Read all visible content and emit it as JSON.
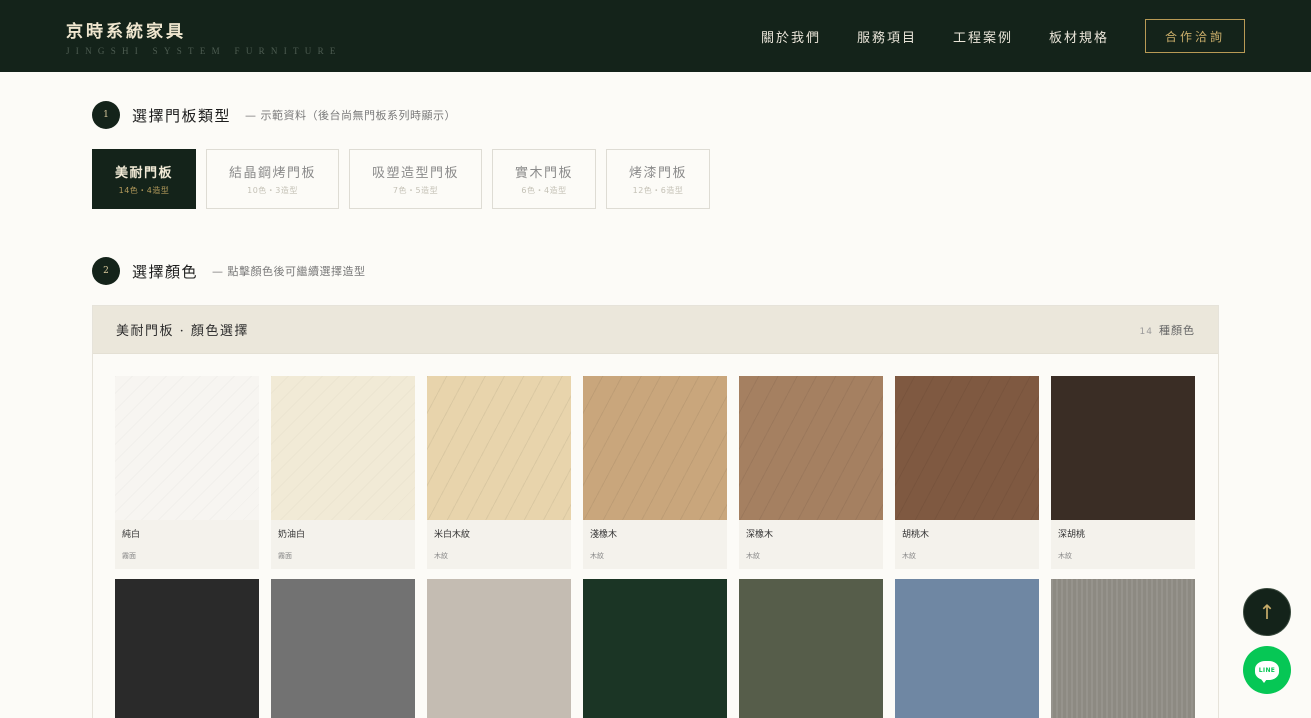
{
  "header": {
    "brand_title": "京時系統家具",
    "brand_subtitle": "JINGSHI SYSTEM FURNITURE",
    "nav": [
      "關於我們",
      "服務項目",
      "工程案例",
      "板材規格"
    ],
    "cta": "合作洽詢"
  },
  "step1": {
    "number": "1",
    "title": "選擇門板類型",
    "note": "— 示範資料（後台尚無門板系列時顯示）"
  },
  "door_types": [
    {
      "label": "美耐門板",
      "sub": "14色・4造型"
    },
    {
      "label": "結晶鋼烤門板",
      "sub": "10色・3造型"
    },
    {
      "label": "吸塑造型門板",
      "sub": "7色・5造型"
    },
    {
      "label": "實木門板",
      "sub": "6色・4造型"
    },
    {
      "label": "烤漆門板",
      "sub": "12色・6造型"
    }
  ],
  "step2": {
    "number": "2",
    "title": "選擇顏色",
    "note": "— 點擊顏色後可繼續選擇造型"
  },
  "panel": {
    "title": "美耐門板 · 顏色選擇",
    "count_num": "14",
    "count_label": "種顏色"
  },
  "colors_row1": [
    {
      "name": "純白",
      "category": "霧面",
      "hex": "#f7f5f1"
    },
    {
      "name": "奶油白",
      "category": "霧面",
      "hex": "#f1ead6"
    },
    {
      "name": "米白木紋",
      "category": "木紋",
      "hex": "#e8d4ac"
    },
    {
      "name": "淺橡木",
      "category": "木紋",
      "hex": "#c9a67c"
    },
    {
      "name": "深橡木",
      "category": "木紋",
      "hex": "#a58061"
    },
    {
      "name": "胡桃木",
      "category": "木紋",
      "hex": "#7f5941"
    },
    {
      "name": "深胡桃",
      "category": "木紋",
      "hex": "#3a2d25"
    }
  ],
  "colors_row2": [
    {
      "hex": "#2a2a2a"
    },
    {
      "hex": "#727272"
    },
    {
      "hex": "#c4bcb2"
    },
    {
      "hex": "#1b3525"
    },
    {
      "hex": "#565d4a"
    },
    {
      "hex": "#6f87a3"
    },
    {
      "hex": "#8d8a82"
    }
  ],
  "icons": {
    "back_to_top": "arrow-up-icon",
    "line_chat": "line-chat-icon",
    "line_text": "LINE"
  }
}
